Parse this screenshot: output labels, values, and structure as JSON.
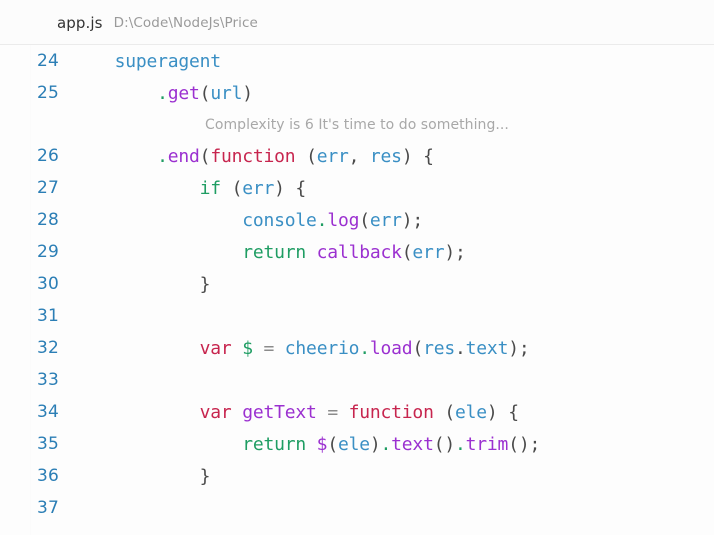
{
  "header": {
    "file_name": "app.js",
    "file_path": "D:\\Code\\NodeJs\\Price"
  },
  "editor": {
    "first_line_number": 24,
    "last_line_number": 37,
    "hint": "Complexity is 6 It's time to do something...",
    "colors": {
      "background": "#fdfdfd",
      "line_number": "#2b7eb5",
      "keyword": "#c7254e",
      "control": "#1f9d63",
      "identifier": "#3a8fc4",
      "property": "#9b30d0",
      "operator": "#8b8b8b",
      "hint": "#a8a8a8",
      "punctuation": "#4a4a4a"
    },
    "lines": [
      {
        "number": "24",
        "text": "    superagent"
      },
      {
        "number": "25",
        "text": "        .get(url)"
      },
      {
        "number": "26",
        "text": "        .end(function (err, res) {"
      },
      {
        "number": "27",
        "text": "            if (err) {"
      },
      {
        "number": "28",
        "text": "                console.log(err);"
      },
      {
        "number": "29",
        "text": "                return callback(err);"
      },
      {
        "number": "30",
        "text": "            }"
      },
      {
        "number": "31",
        "text": ""
      },
      {
        "number": "32",
        "text": "            var $ = cheerio.load(res.text);"
      },
      {
        "number": "33",
        "text": ""
      },
      {
        "number": "34",
        "text": "            var getText = function (ele) {"
      },
      {
        "number": "35",
        "text": "                return $(ele).text().trim();"
      },
      {
        "number": "36",
        "text": "            }"
      },
      {
        "number": "37",
        "text": ""
      }
    ]
  }
}
